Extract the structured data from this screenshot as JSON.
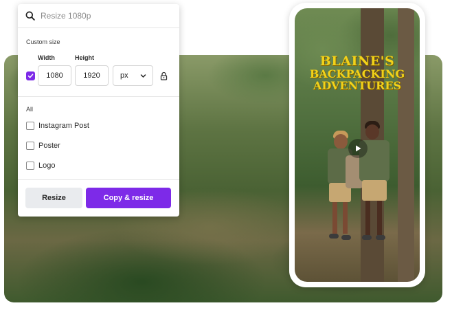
{
  "search": {
    "placeholder": "Resize 1080p",
    "icon": "search-icon"
  },
  "custom_size": {
    "section_label": "Custom size",
    "width_label": "Width",
    "height_label": "Height",
    "width_value": "1080",
    "height_value": "1920",
    "unit": "px",
    "checked": true
  },
  "formats": {
    "section_label": "All",
    "items": [
      {
        "label": "Instagram Post",
        "checked": false
      },
      {
        "label": "Poster",
        "checked": false
      },
      {
        "label": "Logo",
        "checked": false
      }
    ]
  },
  "actions": {
    "resize_label": "Resize",
    "copy_resize_label": "Copy & resize"
  },
  "preview": {
    "title_line1": "BLAINE'S",
    "title_line2": "BACKPACKING",
    "title_line3": "ADVENTURES"
  },
  "colors": {
    "accent": "#7d2ae8",
    "title_yellow": "#f2d21a"
  }
}
